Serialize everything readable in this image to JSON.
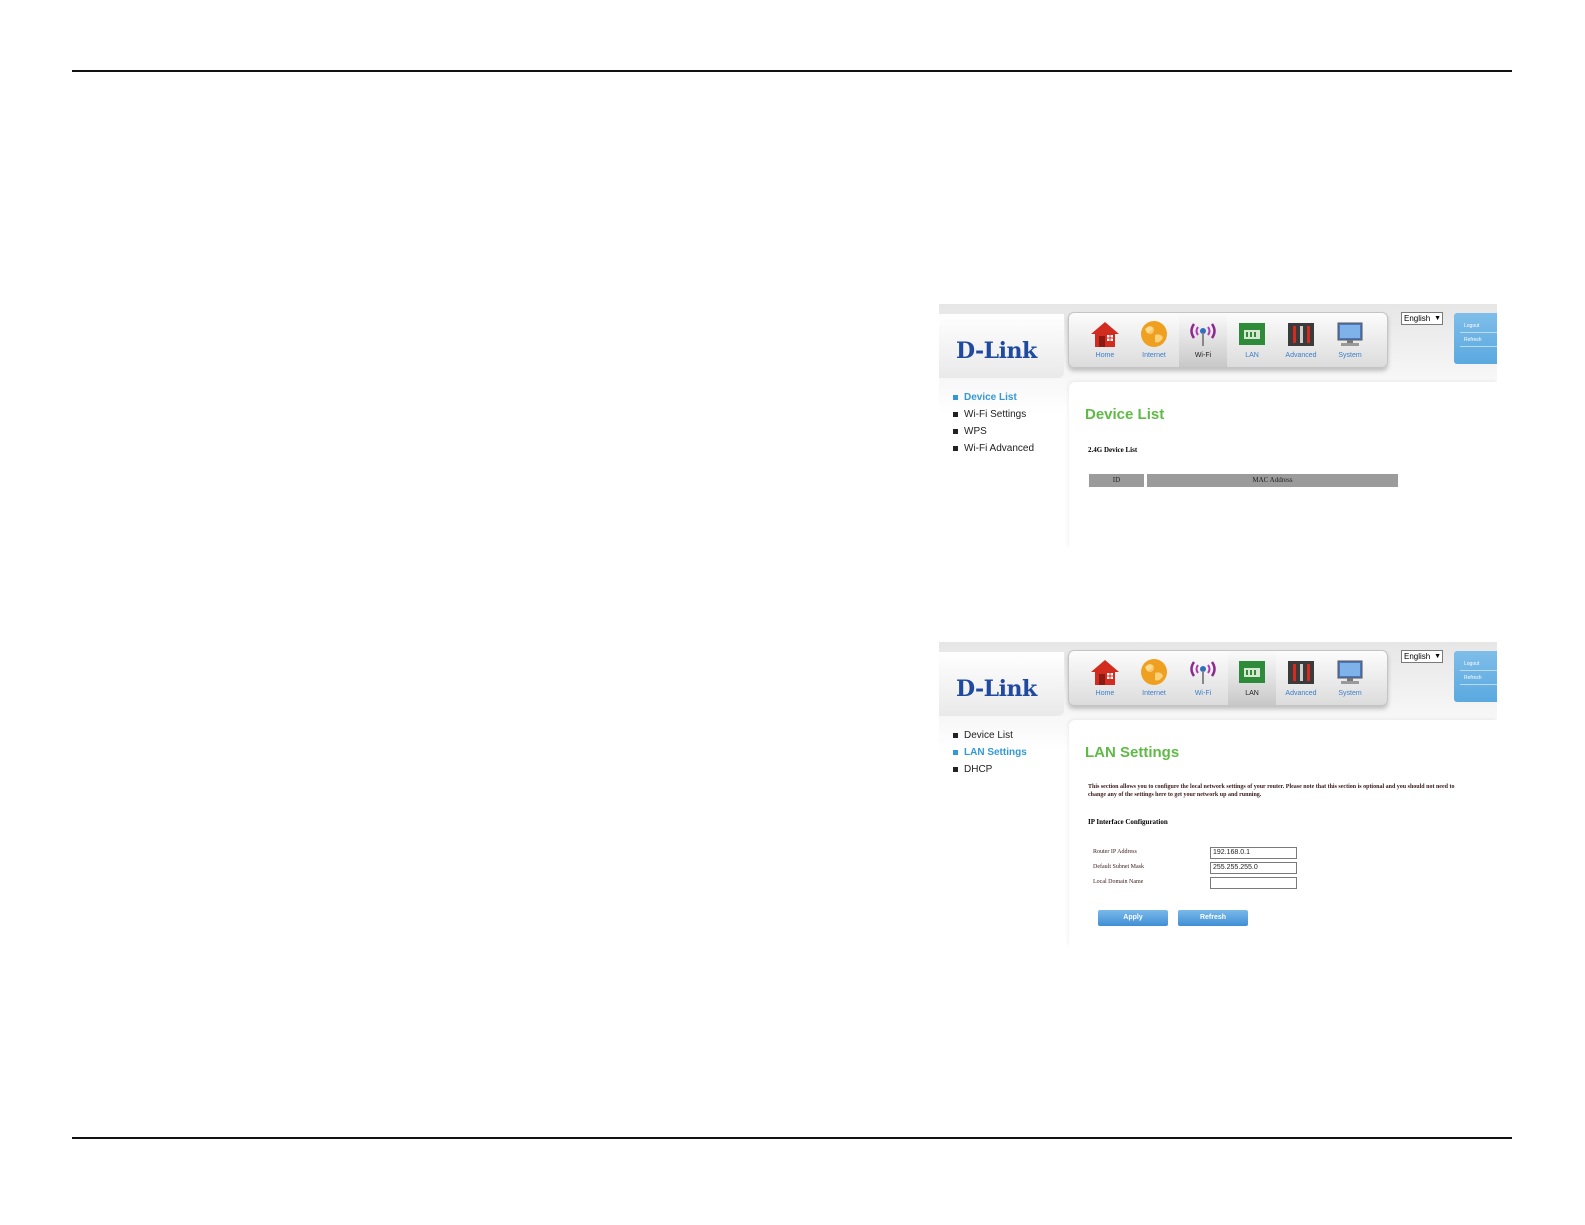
{
  "brand": {
    "logo_text": "D-Link",
    "logo_color": "#1f4aa0",
    "accent_green": "#5fba46",
    "accent_blue": "#3399d6"
  },
  "nav": {
    "items": [
      {
        "label": "Home",
        "icon": "home-icon"
      },
      {
        "label": "Internet",
        "icon": "globe-icon"
      },
      {
        "label": "Wi-Fi",
        "icon": "wifi-icon"
      },
      {
        "label": "LAN",
        "icon": "lan-icon"
      },
      {
        "label": "Advanced",
        "icon": "tools-icon"
      },
      {
        "label": "System",
        "icon": "monitor-icon"
      }
    ]
  },
  "language": {
    "selected": "English"
  },
  "session": {
    "logout_label": "Logout",
    "refresh_label": "Refresh"
  },
  "shot1": {
    "active_nav": "Wi-Fi",
    "menu": [
      "Device List",
      "Wi-Fi Settings",
      "WPS",
      "Wi-Fi Advanced"
    ],
    "active_menu": "Device List",
    "title": "Device List",
    "section": "2.4G Device List",
    "table_headers": [
      "ID",
      "MAC Address"
    ]
  },
  "shot2": {
    "active_nav": "LAN",
    "menu": [
      "Device List",
      "LAN Settings",
      "DHCP"
    ],
    "active_menu": "LAN Settings",
    "title": "LAN Settings",
    "description": "This section allows you to configure the local network settings of your router. Please note that this section is optional and you should not need to change any of the settings here to get your network up and running.",
    "section": "IP Interface Configuration",
    "fields": [
      {
        "label": "Router IP Address",
        "value": "192.168.0.1"
      },
      {
        "label": "Default Subnet Mask",
        "value": "255.255.255.0"
      },
      {
        "label": "Local Domain Name",
        "value": ""
      }
    ],
    "apply_label": "Apply",
    "refresh_label": "Refresh"
  }
}
